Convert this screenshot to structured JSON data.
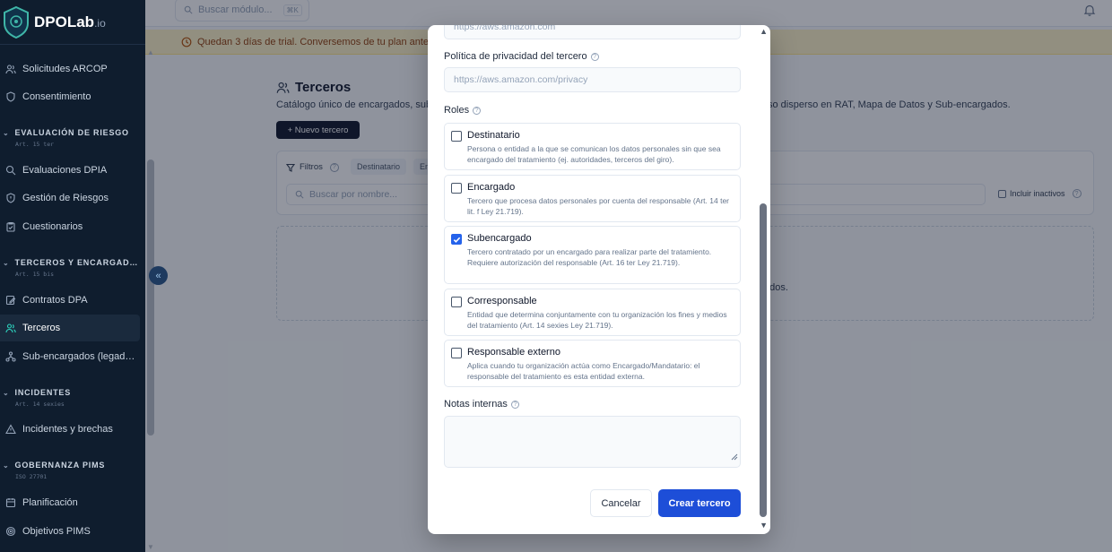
{
  "brand": {
    "name": "DPOLab",
    "suffix": ".io"
  },
  "sidebar": {
    "items_top": [
      {
        "label": "Solicitudes ARCOP",
        "icon": "users-icon"
      },
      {
        "label": "Consentimiento",
        "icon": "shield-icon"
      }
    ],
    "sections": [
      {
        "title": "EVALUACIÓN DE RIESGO",
        "sub": "Art. 15 ter",
        "items": [
          {
            "label": "Evaluaciones DPIA"
          },
          {
            "label": "Gestión de Riesgos"
          },
          {
            "label": "Cuestionarios"
          }
        ]
      },
      {
        "title": "TERCEROS Y ENCARGAD…",
        "sub": "Art. 15 bis",
        "items": [
          {
            "label": "Contratos DPA"
          },
          {
            "label": "Terceros"
          },
          {
            "label": "Sub-encargados (legad…"
          }
        ]
      },
      {
        "title": "INCIDENTES",
        "sub": "Art. 14 sexies",
        "items": [
          {
            "label": "Incidentes y brechas"
          }
        ]
      },
      {
        "title": "GOBERNANZA PIMS",
        "sub": "ISO 27701",
        "items": [
          {
            "label": "Planificación"
          },
          {
            "label": "Objetivos PIMS"
          }
        ]
      }
    ]
  },
  "topbar": {
    "search_placeholder": "Buscar módulo...",
    "shortcut": "⌘K"
  },
  "trial": {
    "text": "Quedan 3 días de trial. Conversemos de tu plan antes"
  },
  "page": {
    "title": "Terceros",
    "description": "Catálogo único de encargados, sub",
    "description_tail": "so disperso en RAT, Mapa de Datos y Sub-encargados.",
    "new_button": "+ Nuevo tercero",
    "filters_label": "Filtros",
    "chips": [
      "Destinatario",
      "En"
    ],
    "search_placeholder": "Buscar por nombre...",
    "include_inactive": "Incluir inactivos",
    "empty_tail": "ndos."
  },
  "modal": {
    "website_value": "https://aws.amazon.com",
    "privacy_label": "Política de privacidad del tercero",
    "privacy_value": "https://aws.amazon.com/privacy",
    "roles_label": "Roles",
    "roles": [
      {
        "title": "Destinatario",
        "desc": "Persona o entidad a la que se comunican los datos personales sin que sea encargado del tratamiento (ej. autoridades, terceros del giro).",
        "checked": false
      },
      {
        "title": "Encargado",
        "desc": "Tercero que procesa datos personales por cuenta del responsable (Art. 14 ter lit. f Ley 21.719).",
        "checked": false
      },
      {
        "title": "Subencargado",
        "desc": "Tercero contratado por un encargado para realizar parte del tratamiento. Requiere autorización del responsable (Art. 16 ter Ley 21.719).",
        "checked": true
      },
      {
        "title": "Corresponsable",
        "desc": "Entidad que determina conjuntamente con tu organización los fines y medios del tratamiento (Art. 14 sexies Ley 21.719).",
        "checked": false
      },
      {
        "title": "Responsable externo",
        "desc": "Aplica cuando tu organización actúa como Encargado/Mandatario: el responsable del tratamiento es esta entidad externa.",
        "checked": false
      }
    ],
    "notes_label": "Notas internas",
    "cancel": "Cancelar",
    "create": "Crear tercero"
  },
  "colors": {
    "sidebar_bg": "#0f1d2e",
    "accent": "#1d4ed8",
    "active_icon": "#2dd4bf",
    "trial_bg": "#fef3c7"
  }
}
